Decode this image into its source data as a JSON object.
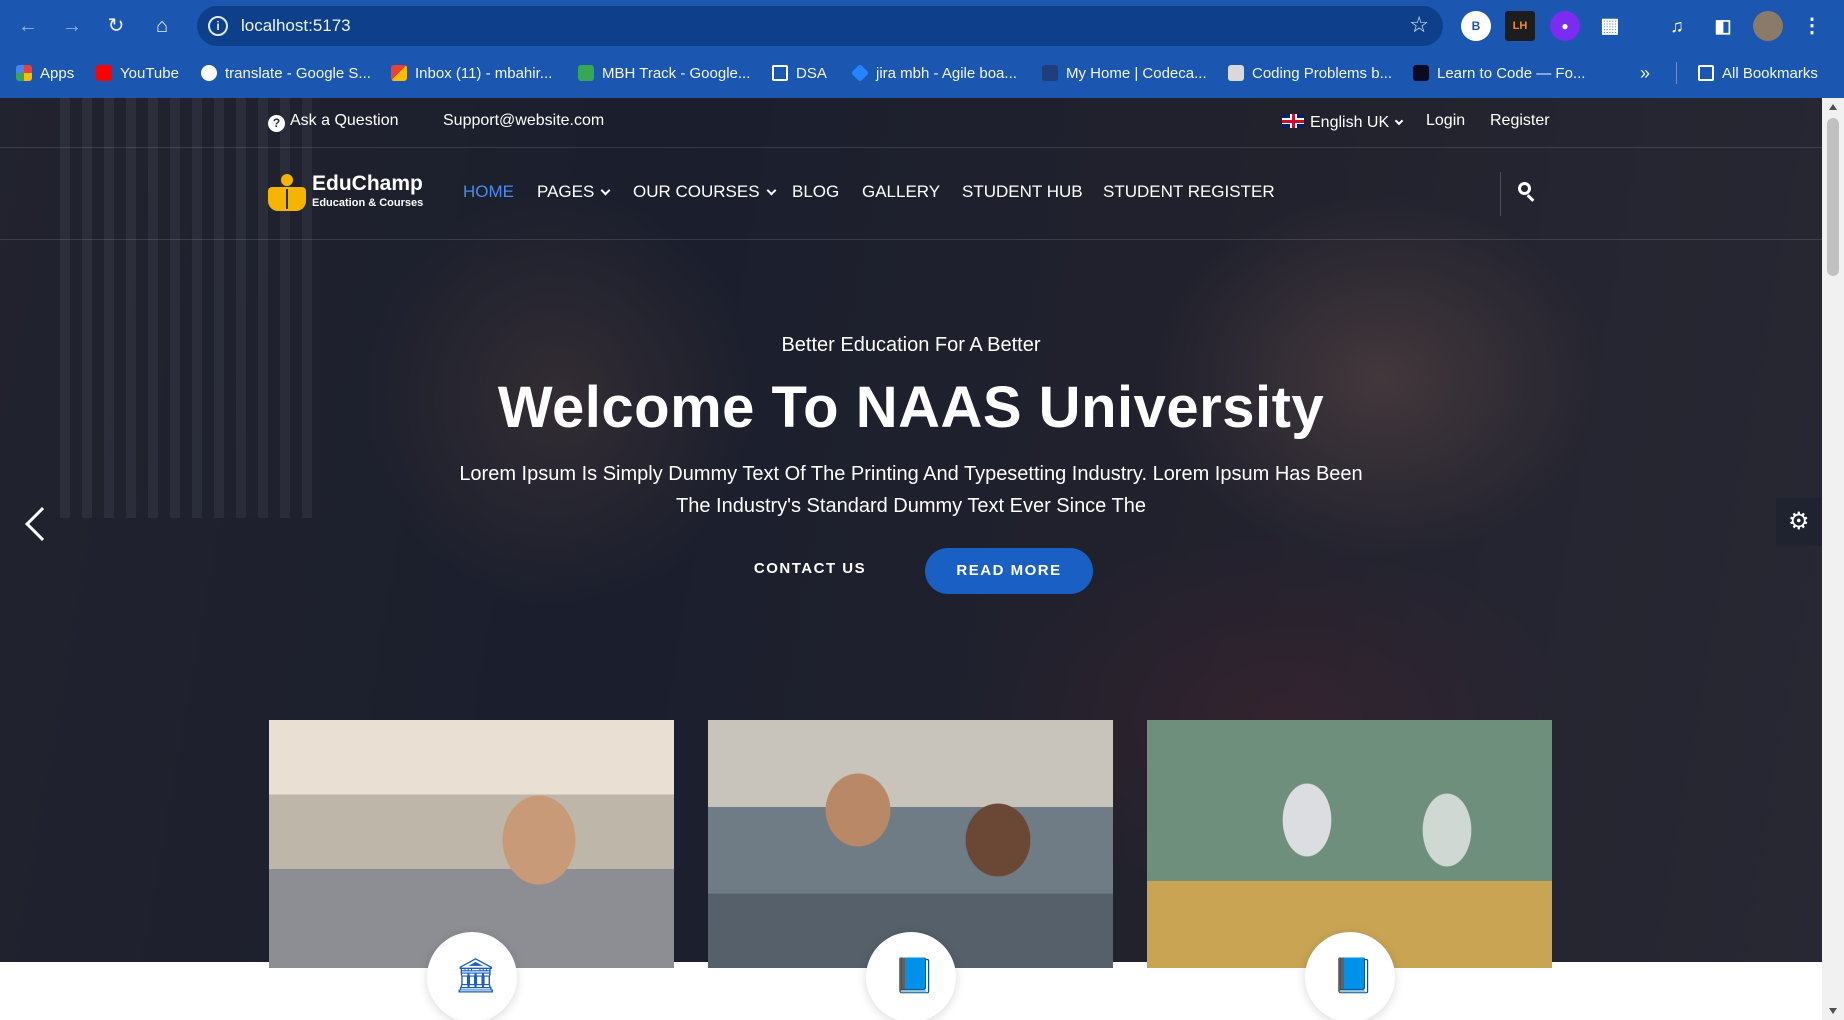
{
  "browser": {
    "url": "localhost:5173",
    "profile_initial": "B",
    "extension_lh": "LH",
    "bookmarks": [
      {
        "label": "Apps",
        "icon": "apps-grid-icon"
      },
      {
        "label": "YouTube",
        "icon": "youtube-icon"
      },
      {
        "label": "translate - Google S...",
        "icon": "google-icon"
      },
      {
        "label": "Inbox (11) - mbahir...",
        "icon": "gmail-icon"
      },
      {
        "label": "MBH Track - Google...",
        "icon": "sheets-icon"
      },
      {
        "label": "DSA",
        "icon": "folder-icon"
      },
      {
        "label": "jira mbh - Agile boa...",
        "icon": "jira-icon"
      },
      {
        "label": "My Home | Codeca...",
        "icon": "codecademy-icon"
      },
      {
        "label": "Coding Problems b...",
        "icon": "cc-icon"
      },
      {
        "label": "Learn to Code — Fo...",
        "icon": "freecodecamp-icon"
      }
    ],
    "more_bookmarks": "»",
    "all_bookmarks": "All Bookmarks"
  },
  "topbar": {
    "ask": "Ask a Question",
    "email": "Support@website.com",
    "language": "English UK",
    "login": "Login",
    "register": "Register"
  },
  "logo": {
    "name": "EduChamp",
    "tagline": "Education & Courses"
  },
  "nav": {
    "home": "HOME",
    "pages": "PAGES",
    "courses": "OUR COURSES",
    "blog": "BLOG",
    "gallery": "GALLERY",
    "hub": "STUDENT HUB",
    "register": "STUDENT REGISTER"
  },
  "hero": {
    "eyebrow": "Better Education For A Better",
    "title": "Welcome To NAAS University",
    "description": "Lorem Ipsum Is Simply Dummy Text Of The Printing And Typesetting Industry. Lorem Ipsum Has Been The Industry's Standard Dummy Text Ever Since The",
    "contact_label": "CONTACT US",
    "read_label": "READ MORE"
  },
  "cards": [
    {
      "icon": "university-building-icon"
    },
    {
      "icon": "book-icon"
    },
    {
      "icon": "book-icon"
    }
  ],
  "colors": {
    "accent": "#1a5fc4",
    "active_nav": "#4a8bf0",
    "logo_yellow": "#f5b400",
    "browser_chrome": "#1b57b0"
  }
}
